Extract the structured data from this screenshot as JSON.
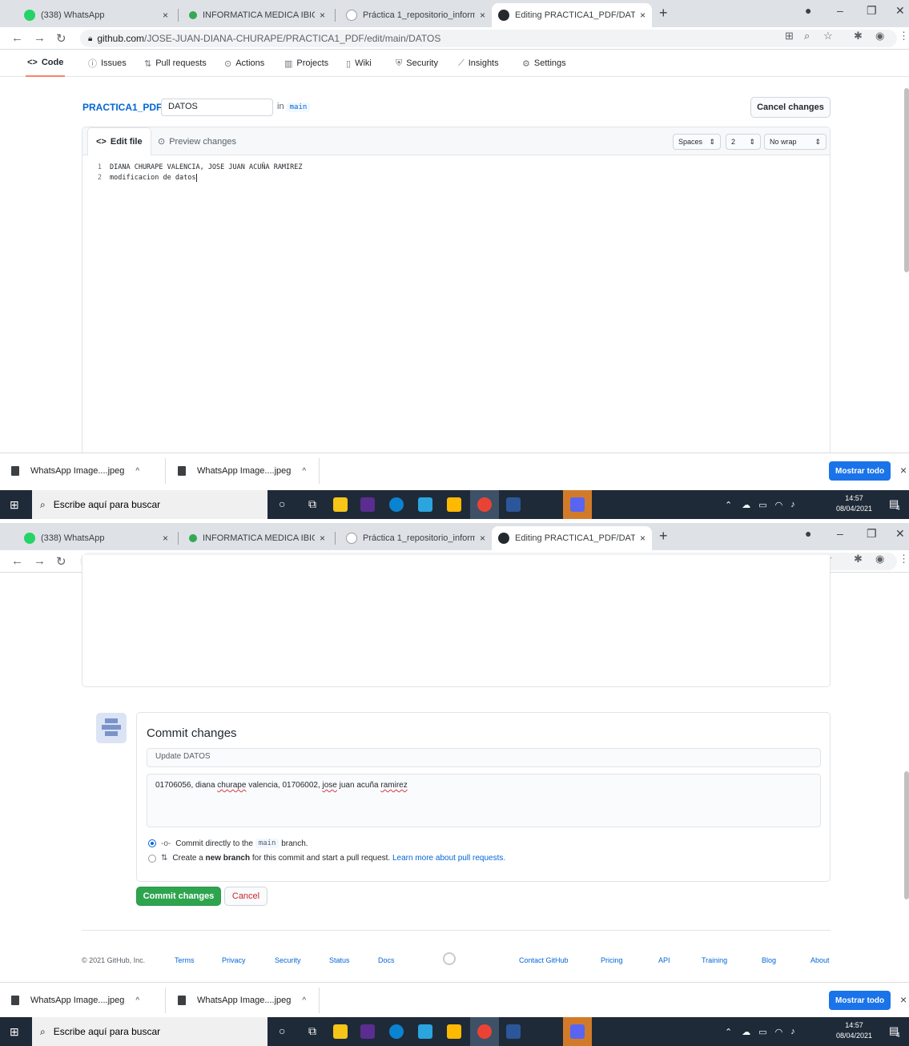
{
  "browser": {
    "tabs": [
      {
        "title": "(338) WhatsApp",
        "close": "×"
      },
      {
        "title": "INFORMATICA MEDICA IBIO: MA",
        "close": "×"
      },
      {
        "title": "Práctica 1_repositorio_informatic",
        "close": "×"
      },
      {
        "title": "Editing PRACTICA1_PDF/DATOS",
        "close": "×"
      }
    ],
    "new_tab": "+",
    "url_host": "github.com",
    "url_path": "/JOSE-JUAN-DIANA-CHURAPE/PRACTICA1_PDF/edit/main/DATOS"
  },
  "repo_nav": [
    {
      "label": "Code",
      "icon": "<>"
    },
    {
      "label": "Issues",
      "icon": "ⓘ"
    },
    {
      "label": "Pull requests",
      "icon": "⇅"
    },
    {
      "label": "Actions",
      "icon": "⊙"
    },
    {
      "label": "Projects",
      "icon": "▥"
    },
    {
      "label": "Wiki",
      "icon": "▯"
    },
    {
      "label": "Security",
      "icon": "⛨"
    },
    {
      "label": "Insights",
      "icon": "⟋"
    },
    {
      "label": "Settings",
      "icon": "⚙"
    }
  ],
  "editor": {
    "repo": "PRACTICA1_PDF",
    "separator": "/",
    "filename": "DATOS",
    "in_label": "in",
    "branch": "main",
    "cancel": "Cancel changes",
    "tab_edit": "Edit file",
    "tab_edit_icon": "<>",
    "tab_preview": "Preview changes",
    "indent_mode": "Spaces",
    "indent_size": "2",
    "wrap_mode": "No wrap",
    "lines": [
      {
        "n": "1",
        "text": "DIANA CHURAPE VALENCIA, JOSE JUAN ACUÑA RAMIREZ"
      },
      {
        "n": "2",
        "text": "modificacion de datos"
      }
    ]
  },
  "commit": {
    "heading": "Commit changes",
    "summary_placeholder": "Update DATOS",
    "description_parts": [
      "01706056, diana ",
      "churape",
      " valencia, 01706002, ",
      "jose",
      " juan acuña ",
      "ramirez"
    ],
    "opt1_pre": "Commit directly to the",
    "opt1_branch": "main",
    "opt1_post": "branch.",
    "opt2_pre": "Create a",
    "opt2_bold": "new branch",
    "opt2_mid": "for this commit and start a pull request.",
    "opt2_link": "Learn more about pull requests.",
    "submit": "Commit changes",
    "cancel": "Cancel"
  },
  "footer": {
    "copyright": "© 2021 GitHub, Inc.",
    "links_left": [
      "Terms",
      "Privacy",
      "Security",
      "Status",
      "Docs"
    ],
    "links_right": [
      "Contact GitHub",
      "Pricing",
      "API",
      "Training",
      "Blog",
      "About"
    ]
  },
  "downloads": {
    "items": [
      "WhatsApp Image....jpeg",
      "WhatsApp Image....jpeg"
    ],
    "show_all": "Mostrar todo",
    "close": "×"
  },
  "taskbar": {
    "search_placeholder": "Escribe aquí para buscar",
    "time": "14:57",
    "date": "08/04/2021",
    "notifications": "4"
  },
  "colors": {
    "github_green": "#2ea44f",
    "link_blue": "#0366d6",
    "taskbar": "#1f2a38",
    "download_button": "#1a73e8"
  }
}
